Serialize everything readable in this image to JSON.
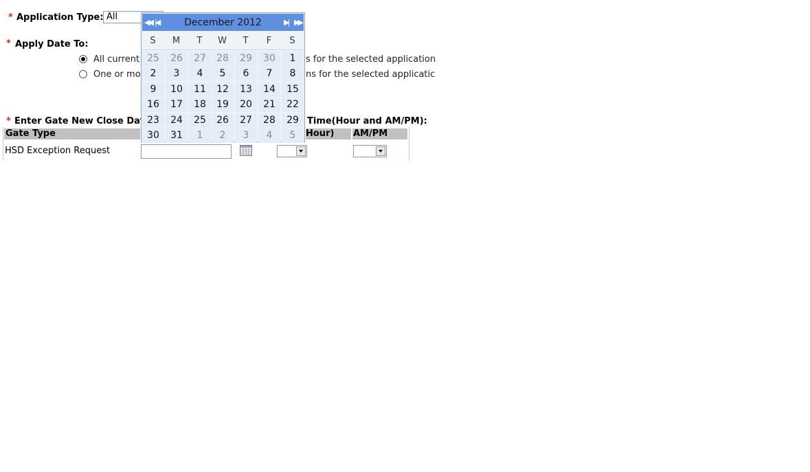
{
  "form": {
    "required_mark": "*",
    "application_type_label": "Application Type:",
    "application_type_value": "All",
    "apply_date_label": "Apply Date To:",
    "radio1_left": "All current",
    "radio1_right": "s for the selected application",
    "radio2_left": "One or mo",
    "radio2_right": "ns for the selected applicatic",
    "enter_gate_label_left": "Enter Gate New Close Dat",
    "enter_gate_label_right": "Time(Hour and AM/PM):"
  },
  "table": {
    "headers": {
      "gate_type": "Gate Type",
      "hour": "Hour)",
      "ampm": "AM/PM"
    },
    "rows": [
      {
        "gate_type": "HSD Exception Request"
      }
    ]
  },
  "calendar": {
    "title": "December 2012",
    "nav": {
      "prev_year": "◀◀",
      "prev_month": "|◀",
      "next_month": "▶|",
      "next_year": "▶▶"
    },
    "weekdays": [
      "S",
      "M",
      "T",
      "W",
      "T",
      "F",
      "S"
    ],
    "weeks": [
      [
        "25",
        "26",
        "27",
        "28",
        "29",
        "30",
        "1"
      ],
      [
        "2",
        "3",
        "4",
        "5",
        "6",
        "7",
        "8"
      ],
      [
        "9",
        "10",
        "11",
        "12",
        "13",
        "14",
        "15"
      ],
      [
        "16",
        "17",
        "18",
        "19",
        "20",
        "21",
        "22"
      ],
      [
        "23",
        "24",
        "25",
        "26",
        "27",
        "28",
        "29"
      ],
      [
        "30",
        "31",
        "1",
        "2",
        "3",
        "4",
        "5"
      ]
    ],
    "outside_month": [
      [
        true,
        true,
        true,
        true,
        true,
        true,
        false
      ],
      [
        false,
        false,
        false,
        false,
        false,
        false,
        false
      ],
      [
        false,
        false,
        false,
        false,
        false,
        false,
        false
      ],
      [
        false,
        false,
        false,
        false,
        false,
        false,
        false
      ],
      [
        false,
        false,
        false,
        false,
        false,
        false,
        false
      ],
      [
        false,
        false,
        true,
        true,
        true,
        true,
        true
      ]
    ],
    "colors": {
      "header": "#5f8fe0",
      "cell": "#e4edf7"
    }
  },
  "icons": {
    "calendar_button": "calendar-icon",
    "dropdown": "chevron-down-icon"
  }
}
